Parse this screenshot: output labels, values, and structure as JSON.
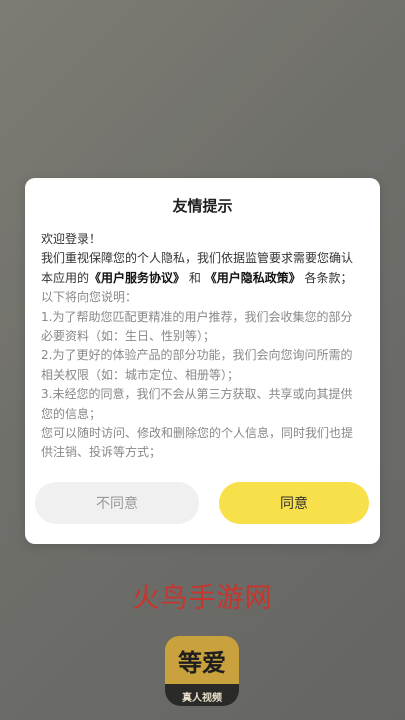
{
  "dialog": {
    "title": "友情提示",
    "greeting": "欢迎登录！",
    "intro_pre": "我们重视保障您的个人隐私，我们依据监管要求需要您确认本应用的",
    "user_agreement": "《用户服务协议》",
    "and": "和",
    "privacy_policy": "《用户隐私政策》",
    "intro_post": "各条款；",
    "explain_header": "以下将向您说明：",
    "point1": "1.为了帮助您匹配更精准的用户推荐，我们会收集您的部分必要资料（如：生日、性别等）；",
    "point2": "2.为了更好的体验产品的部分功能，我们会向您询问所需的相关权限（如：城市定位、相册等）；",
    "point3": "3.未经您的同意，我们不会从第三方获取、共享或向其提供您的信息；",
    "rights": "您可以随时访问、修改和删除您的个人信息，同时我们也提供注销、投诉等方式；",
    "disagree_label": "不同意",
    "agree_label": "同意"
  },
  "watermark": "火鸟手游网",
  "logo": {
    "name": "等爱",
    "subtitle": "真人视频"
  },
  "colors": {
    "accent": "#f7e04a",
    "watermark": "#c8352d",
    "logo_gold": "#c9a23e"
  }
}
